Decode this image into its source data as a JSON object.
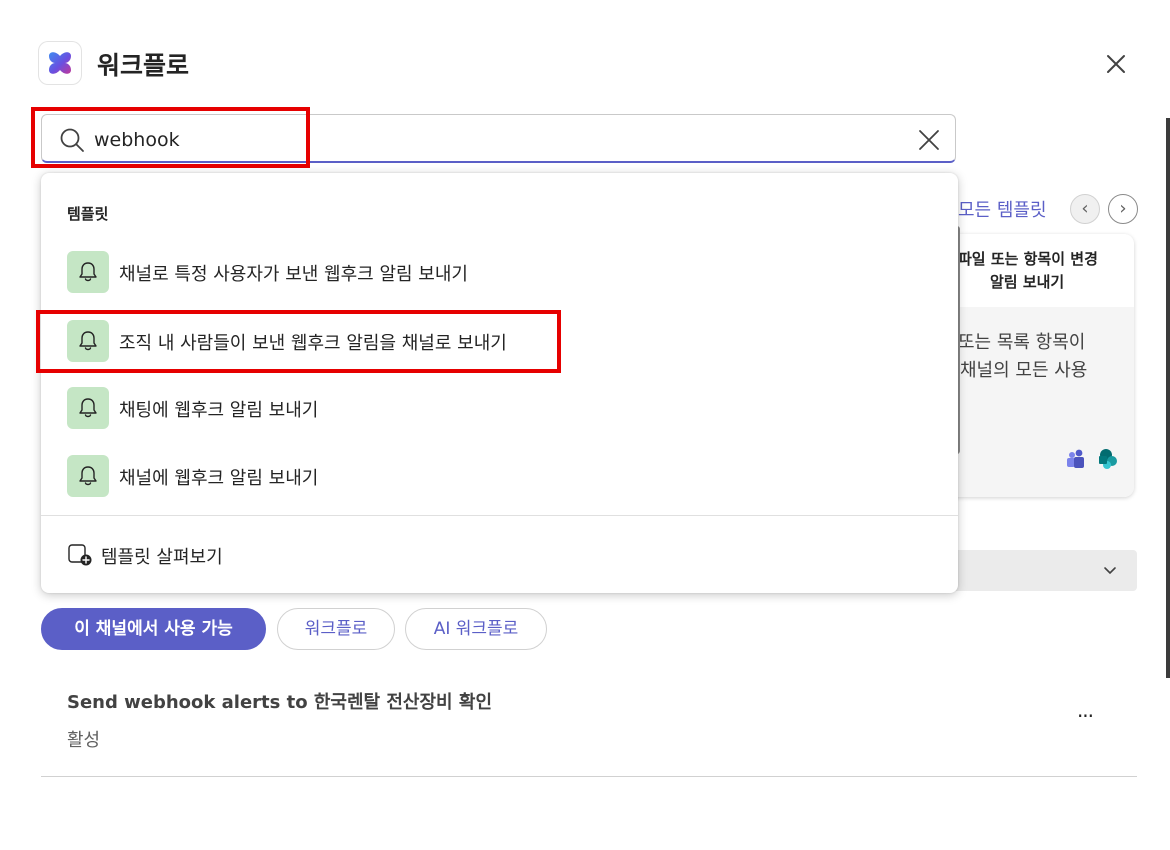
{
  "header": {
    "title": "워크플로"
  },
  "search": {
    "value": "webhook",
    "placeholder": ""
  },
  "suggestions": {
    "section_label": "템플릿",
    "items": [
      {
        "label": "채널로 특정 사용자가 보낸 웹후크 알림 보내기",
        "icon": "bell-icon"
      },
      {
        "label": "조직 내 사람들이 보낸 웹후크 알림을 채널로 보내기",
        "icon": "bell-icon"
      },
      {
        "label": "채팅에 웹후크 알림 보내기",
        "icon": "bell-icon"
      },
      {
        "label": "채널에 웹후크 알림 보내기",
        "icon": "bell-icon"
      }
    ],
    "browse_label": "템플릿 살펴보기"
  },
  "background": {
    "all_templates_link": "모든 템플릿",
    "card": {
      "title_line1": "파일 또는 항목이 변경",
      "title_line2": "알림 보내기",
      "desc_line1": "또는 목록 항목이",
      "desc_line2": "채널의 모든 사용"
    }
  },
  "filters": {
    "active": "이 채널에서 사용 가능",
    "workflows": "워크플로",
    "ai_workflows": "AI 워크플로"
  },
  "workflow": {
    "title": "Send webhook alerts to 한국렌탈 전산장비 확인",
    "status": "활성",
    "more": "···"
  },
  "colors": {
    "accent": "#5b5fc7",
    "highlight": "#e60000",
    "icon_bg": "#c5e6c5"
  }
}
